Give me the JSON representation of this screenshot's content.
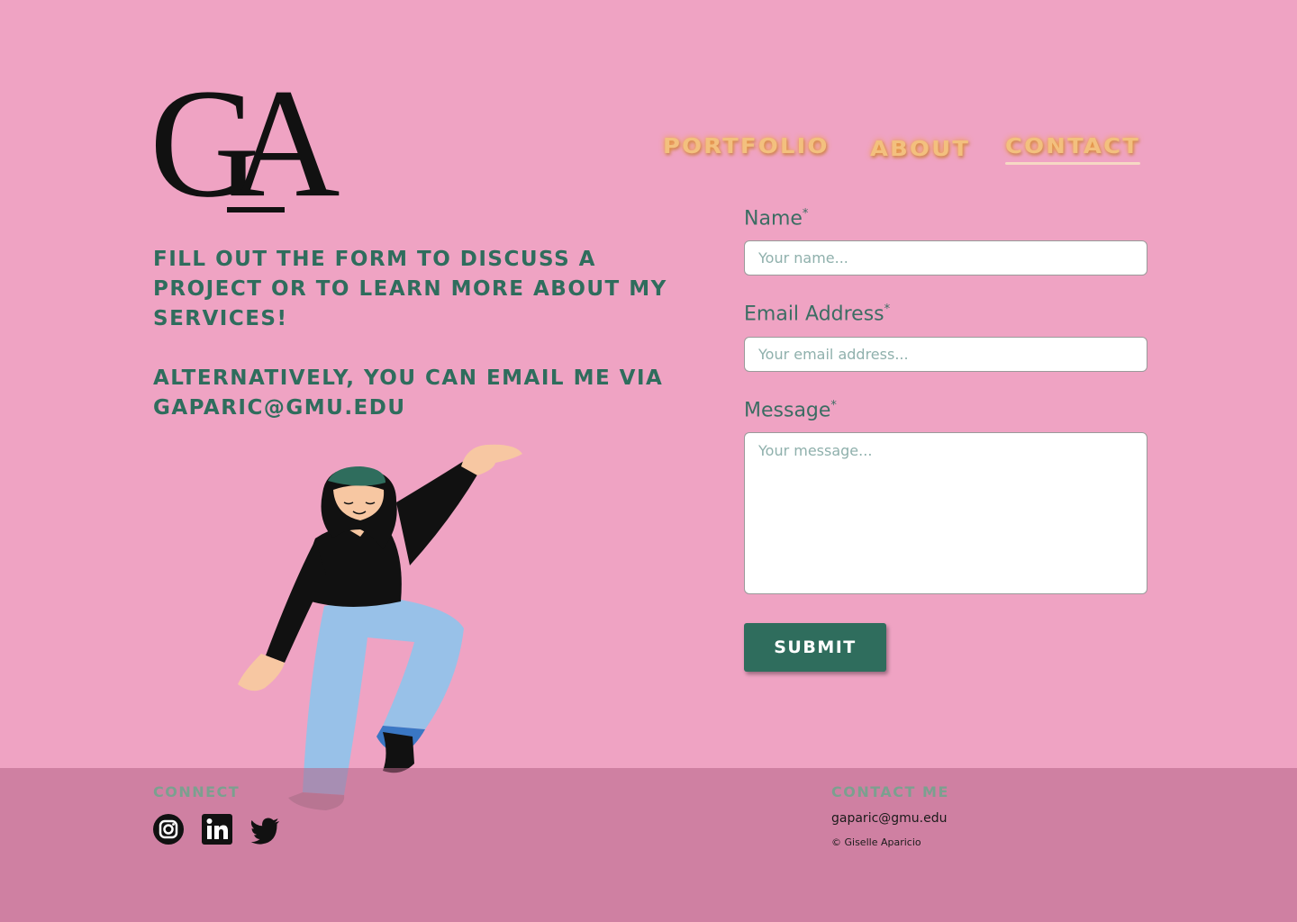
{
  "logo": {
    "text": "GA"
  },
  "nav": {
    "items": [
      {
        "label": "PORTFOLIO"
      },
      {
        "label": "ABOUT"
      },
      {
        "label": "CONTACT",
        "active": true
      }
    ]
  },
  "intro": {
    "line1": "Fill out the form to discuss a project or to learn more about my services!",
    "line2": "Alternatively, you can email me via gaparic@gmu.edu"
  },
  "form": {
    "name": {
      "label": "Name",
      "required_mark": "*",
      "placeholder": "Your name..."
    },
    "email": {
      "label": "Email Address",
      "required_mark": "*",
      "placeholder": "Your email address..."
    },
    "message": {
      "label": "Message",
      "required_mark": "*",
      "placeholder": "Your message..."
    },
    "submit_label": "SUBMIT"
  },
  "footer": {
    "connect_heading": "CONNECT",
    "socials": [
      "instagram-icon",
      "linkedin-icon",
      "twitter-icon"
    ],
    "contact_heading": "CONTACT ME",
    "email": "gaparic@gmu.edu",
    "copyright": "© Giselle Aparicio"
  },
  "colors": {
    "background": "#efa3c3",
    "accent_green": "#2f6d5d",
    "nav_orange": "#f3c07e",
    "footer_band": "#c47d99"
  }
}
